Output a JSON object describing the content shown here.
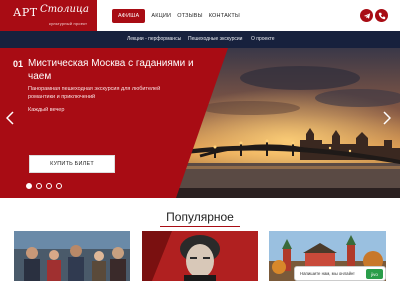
{
  "header": {
    "logo_main": "АРТ",
    "logo_script": "Столица",
    "logo_tagline": "культурный проект",
    "nav": [
      "АФИША",
      "АКЦИИ",
      "ОТЗЫВЫ",
      "КОНТАКТЫ"
    ],
    "telegram_icon": "telegram-icon",
    "phone_icon": "phone-icon"
  },
  "subnav": [
    "Лекции - перформансы",
    "Пешеходные экскурсии",
    "О проекте"
  ],
  "hero": {
    "slide_number": "01",
    "title": "Мистическая Москва с гаданиями и чаем",
    "subtitle": "Панорамная пешеходная экскурсия для любителей романтики и приключений",
    "schedule": "Каждый вечер",
    "button": "КУПИТЬ БИЛЕТ",
    "active_slide": 1,
    "slide_count": 4
  },
  "popular": {
    "title": "Популярное"
  },
  "chat": {
    "text": "Напишите нам, мы онлайн!",
    "badge": "jivo"
  },
  "colors": {
    "accent": "#a80c14",
    "subnav_bg": "#17213d"
  }
}
